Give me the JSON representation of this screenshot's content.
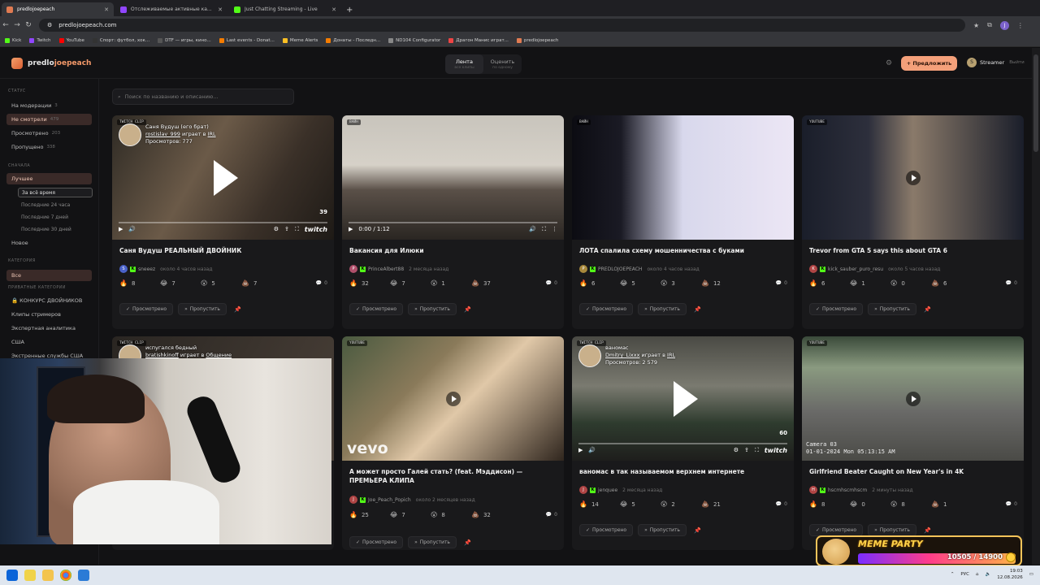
{
  "browser": {
    "tabs": [
      {
        "title": "predlojoepeach",
        "color": "#e07b52"
      },
      {
        "title": "Отслеживаемые активные ка...",
        "color": "#9146ff"
      },
      {
        "title": "Just Chatting Streaming - Live",
        "color": "#53fc18"
      }
    ],
    "url": "predlojoepeach.com",
    "profile_letter": "J",
    "bookmarks": [
      {
        "label": "Kick",
        "color": "#53fc18"
      },
      {
        "label": "Twitch",
        "color": "#9146ff"
      },
      {
        "label": "YouTube",
        "color": "#ff0000"
      },
      {
        "label": "Спорт: футбол, хок...",
        "color": "#333"
      },
      {
        "label": "DTF — игры, кино...",
        "color": "#555"
      },
      {
        "label": "Last events - Donat...",
        "color": "#f57c00"
      },
      {
        "label": "Meme Alerts",
        "color": "#fbbf24"
      },
      {
        "label": "Донаты - Последн...",
        "color": "#f57c00"
      },
      {
        "label": "ND104 Configurator",
        "color": "#888"
      },
      {
        "label": "Драгон Манис играт...",
        "color": "#ef4444"
      },
      {
        "label": "predlojoepeach",
        "color": "#e07b52"
      }
    ]
  },
  "header": {
    "logo_plain": "predlo",
    "logo_accent": "joepeach",
    "tabs": [
      {
        "label": "Лента",
        "sub": "все клипы"
      },
      {
        "label": "Оценить",
        "sub": "по одному"
      }
    ],
    "suggest_label": "+ Предложить",
    "user_initial": "S",
    "user_name": "Streamer",
    "logout": "Выйти"
  },
  "sidebar": {
    "status_title": "СТАТУС",
    "status": [
      {
        "label": "На модерации",
        "count": "3"
      },
      {
        "label": "Не смотрели",
        "count": "479"
      },
      {
        "label": "Просмотрено",
        "count": "203"
      },
      {
        "label": "Пропущено",
        "count": "338"
      }
    ],
    "sort_title": "СНАЧАЛА",
    "best": "Лучшее",
    "periods": [
      "За всё время",
      "Последние 24 часа",
      "Последние 7 дней",
      "Последние 30 дней"
    ],
    "new": "Новое",
    "cat_title": "КАТЕГОРИЯ",
    "all": "Все",
    "private_title": "ПРИВАТНЫЕ КАТЕГОРИИ",
    "categories": [
      "🔒 КОНКУРС ДВОЙНИКОВ",
      "Клипы стримеров",
      "Экспертная аналитика",
      "США",
      "Экстренные службы США"
    ]
  },
  "search": {
    "placeholder": "Поиск по названию и описанию..."
  },
  "cards": [
    {
      "badge": "TWITCH CLIP",
      "title": "Саня Вудуш РЕАЛЬНЫЙ ДВОЙНИК",
      "user": "sneeez",
      "ua": "S",
      "ua_color": "#4a62c9",
      "ago": "около 4 часов назад",
      "r": [
        "8",
        "7",
        "5",
        "7"
      ],
      "comments": "0",
      "tw_title": "Саня Вудуш (его брат)",
      "tw_user": "rostislav_999",
      "tw_plays": "играет в",
      "tw_game": "IRL",
      "tw_views": "Просмотров: 777",
      "dur": "39"
    },
    {
      "badge": "ВАЙН",
      "title": "Вакансия для Илюки",
      "user": "PrinceAlbert88",
      "ua": "P",
      "ua_color": "#b0506b",
      "ago": "2 месяца назад",
      "r": [
        "32",
        "7",
        "1",
        "37"
      ],
      "comments": "0",
      "time": "0:00 / 1:12"
    },
    {
      "badge": "ВАЙН",
      "title": "ЛОТА спалила схему мошенничества с буками",
      "user": "PREDLOJOEPEACH",
      "ua": "P",
      "ua_color": "#a8893c",
      "ago": "около 4 часов назад",
      "r": [
        "6",
        "5",
        "3",
        "12"
      ],
      "comments": "0"
    },
    {
      "badge": "YOUTUBE",
      "title": "Trevor from GTA 5 says this about GTA 6",
      "user": "kick_sauber_puro_resu",
      "ua": "K",
      "ua_color": "#b04545",
      "ago": "около 5 часов назад",
      "r": [
        "6",
        "1",
        "0",
        "6"
      ],
      "comments": "0"
    },
    {
      "badge": "TWITCH CLIP",
      "title": "испугался бедный",
      "user": "bratishkinoff",
      "ua": "B",
      "ua_color": "#4a62c9",
      "ago": "",
      "r": [
        "",
        "",
        "",
        ""
      ],
      "comments": "",
      "tw_title": "испугался бедный",
      "tw_user": "bratishkinoff",
      "tw_plays": "играет в",
      "tw_game": "Общение"
    },
    {
      "badge": "YOUTUBE",
      "title": "А может просто Галей стать? (feat. Мэддисон) — ПРЕМЬЕРА КЛИПА",
      "user": "Joe_Peach_Popich",
      "ua": "J",
      "ua_color": "#b04545",
      "ago": "около 2 месяцев назад",
      "r": [
        "25",
        "7",
        "8",
        "32"
      ],
      "comments": "0",
      "vevo": "vevo"
    },
    {
      "badge": "TWITCH CLIP",
      "title": "ваномас в так называемом верхнем интернете",
      "user": "jenquee",
      "ua": "J",
      "ua_color": "#b04545",
      "ago": "2 месяца назад",
      "r": [
        "14",
        "5",
        "2",
        "21"
      ],
      "comments": "0",
      "tw_title": "ваномас",
      "tw_user": "Dmitry_Lixxx",
      "tw_plays": "играет в",
      "tw_game": "IRL",
      "tw_views": "Просмотров: 2 579",
      "dur": "60"
    },
    {
      "badge": "YOUTUBE",
      "title": "Girlfriend Beater Caught on New Year's in 4K",
      "user": "hscmhscmhscm",
      "ua": "H",
      "ua_color": "#b04545",
      "ago": "2 минуты назад",
      "r": [
        "8",
        "0",
        "8",
        "1"
      ],
      "comments": "0",
      "cam": "Camera 03",
      "camdate": "01-01-2024 Mon 05:13:15 AM"
    }
  ],
  "actions": {
    "watched": "Просмотрено",
    "skip": "Пропустить"
  },
  "emoji": [
    "🔥",
    "😂",
    "😮",
    "💩"
  ],
  "video": {
    "twitch": "twitch"
  },
  "overlay": {
    "title": "MEME PARTY",
    "value": "10505 / 14900"
  },
  "taskbar": {
    "lang": "РУС",
    "time": "19:03",
    "date": "12.08.2026"
  }
}
